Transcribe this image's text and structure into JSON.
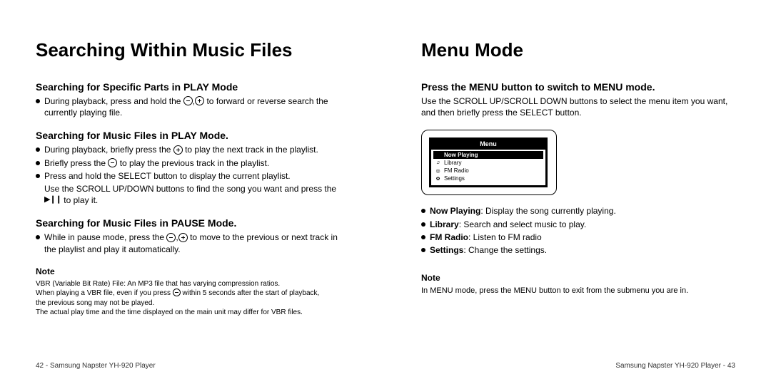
{
  "left": {
    "title": "Searching Within Music Files",
    "s1": {
      "heading": "Searching for Specific Parts in PLAY Mode",
      "b1a": "During playback, press and hold the ",
      "b1b": ",",
      "b1c": " to forward or reverse search the currently playing file."
    },
    "s2": {
      "heading": "Searching for Music Files in PLAY Mode.",
      "b1a": "During playback, briefly press the ",
      "b1b": " to play the next track in the playlist.",
      "b2a": "Briefly press the ",
      "b2b": " to play the previous track in the playlist.",
      "b3": "Press and hold the SELECT button to display the current playlist.",
      "ind1": "Use the SCROLL UP/DOWN buttons to find the song you want and press the",
      "ind2": " to play it."
    },
    "s3": {
      "heading": "Searching for Music Files in PAUSE Mode.",
      "b1a": "While in pause mode, press the ",
      "b1b": ",",
      "b1c": " to move to the previous or next track in the playlist and play it automatically."
    },
    "note": {
      "label": "Note",
      "l1": "VBR (Variable Bit Rate) File: An MP3 file that has varying compression ratios.",
      "l2a": "When playing a VBR file, even if you press ",
      "l2b": " within 5 seconds after the start of playback,",
      "l3": "the previous song may not be played.",
      "l4": "The actual play time and the time displayed on the main unit may differ for VBR files."
    },
    "footer": "42 - Samsung Napster YH-920 Player"
  },
  "right": {
    "title": "Menu Mode",
    "p1": "Press the MENU button to switch to MENU mode.",
    "p2": "Use the SCROLL UP/SCROLL DOWN buttons to select the menu item you want, and then briefly press the SELECT button.",
    "device": {
      "title": "Menu",
      "items": [
        {
          "label": "Now Playing",
          "selected": true
        },
        {
          "label": "Library",
          "selected": false
        },
        {
          "label": "FM Radio",
          "selected": false
        },
        {
          "label": "Settings",
          "selected": false
        }
      ]
    },
    "bullets": {
      "b1k": "Now Playing",
      "b1v": ": Display the song currently playing.",
      "b2k": "Library",
      "b2v": ": Search and select music to play.",
      "b3k": "FM Radio",
      "b3v": ": Listen to FM radio",
      "b4k": "Settings",
      "b4v": ": Change the settings."
    },
    "note": {
      "label": "Note",
      "l1": "In MENU mode, press the MENU button to exit from the submenu you are in."
    },
    "footer": "Samsung Napster YH-920 Player - 43"
  }
}
